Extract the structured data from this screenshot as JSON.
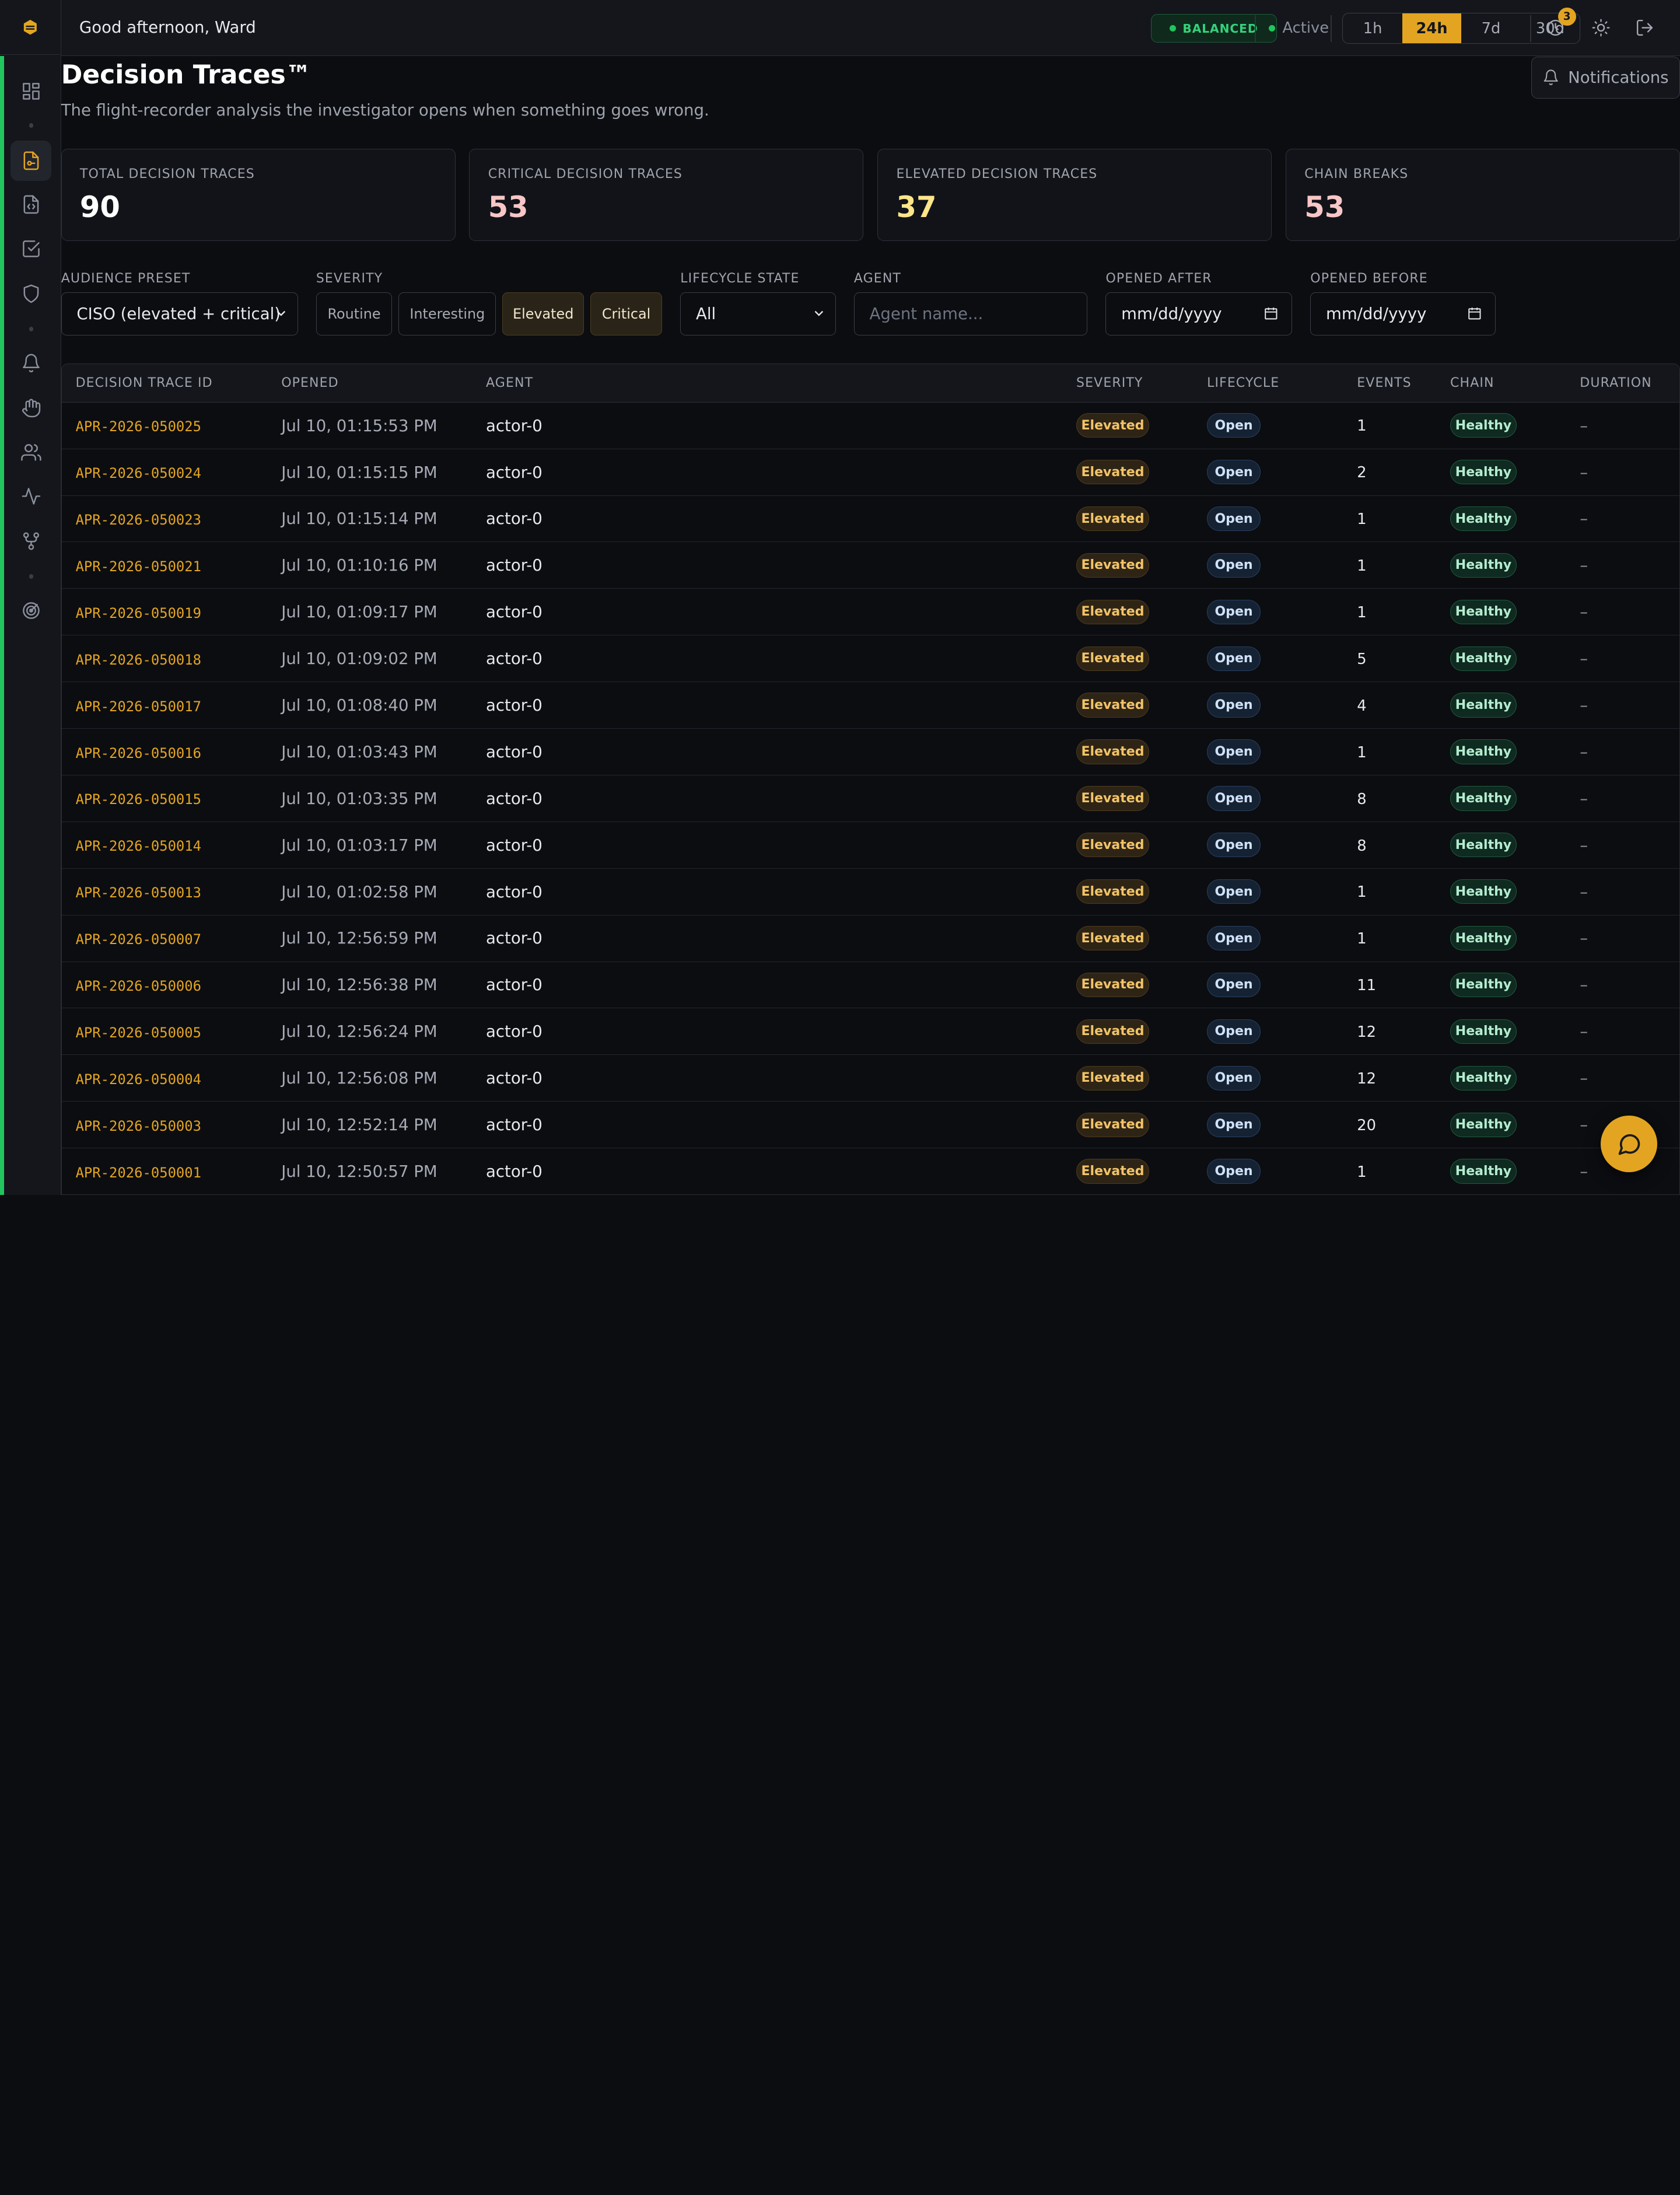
{
  "header": {
    "greeting": "Good afternoon, Ward",
    "mode_badge": "BALANCED",
    "status": "Active",
    "time_ranges": [
      "1h",
      "24h",
      "7d",
      "30d"
    ],
    "selected_range": "24h",
    "notification_count": "3"
  },
  "page": {
    "title": "Decision Traces™",
    "subtitle": "The flight-recorder analysis the investigator opens when something goes wrong.",
    "notifications_button": "Notifications"
  },
  "stats": [
    {
      "label": "TOTAL DECISION TRACES",
      "value": "90",
      "color": "#ffffff"
    },
    {
      "label": "CRITICAL DECISION TRACES",
      "value": "53",
      "color": "#f7c6c6"
    },
    {
      "label": "ELEVATED DECISION TRACES",
      "value": "37",
      "color": "#fde58a"
    },
    {
      "label": "CHAIN BREAKS",
      "value": "53",
      "color": "#f7c6c6"
    }
  ],
  "filters": {
    "audience_label": "AUDIENCE PRESET",
    "audience_value": "CISO (elevated + critical)",
    "severity_label": "SEVERITY",
    "severity_options": [
      "Routine",
      "Interesting",
      "Elevated",
      "Critical"
    ],
    "lifecycle_label": "LIFECYCLE STATE",
    "lifecycle_value": "All",
    "agent_label": "AGENT",
    "agent_placeholder": "Agent name...",
    "after_label": "OPENED AFTER",
    "after_placeholder": "mm/dd/yyyy",
    "before_label": "OPENED BEFORE",
    "before_placeholder": "mm/dd/yyyy"
  },
  "table": {
    "columns": [
      "DECISION TRACE ID",
      "OPENED",
      "AGENT",
      "SEVERITY",
      "LIFECYCLE",
      "EVENTS",
      "CHAIN",
      "DURATION"
    ],
    "rows": [
      [
        "APR-2026-050025",
        "Jul 10, 01:15:53 PM",
        "actor-0",
        "Elevated",
        "Open",
        "1",
        "Healthy",
        "–"
      ],
      [
        "APR-2026-050024",
        "Jul 10, 01:15:15 PM",
        "actor-0",
        "Elevated",
        "Open",
        "2",
        "Healthy",
        "–"
      ],
      [
        "APR-2026-050023",
        "Jul 10, 01:15:14 PM",
        "actor-0",
        "Elevated",
        "Open",
        "1",
        "Healthy",
        "–"
      ],
      [
        "APR-2026-050021",
        "Jul 10, 01:10:16 PM",
        "actor-0",
        "Elevated",
        "Open",
        "1",
        "Healthy",
        "–"
      ],
      [
        "APR-2026-050019",
        "Jul 10, 01:09:17 PM",
        "actor-0",
        "Elevated",
        "Open",
        "1",
        "Healthy",
        "–"
      ],
      [
        "APR-2026-050018",
        "Jul 10, 01:09:02 PM",
        "actor-0",
        "Elevated",
        "Open",
        "5",
        "Healthy",
        "–"
      ],
      [
        "APR-2026-050017",
        "Jul 10, 01:08:40 PM",
        "actor-0",
        "Elevated",
        "Open",
        "4",
        "Healthy",
        "–"
      ],
      [
        "APR-2026-050016",
        "Jul 10, 01:03:43 PM",
        "actor-0",
        "Elevated",
        "Open",
        "1",
        "Healthy",
        "–"
      ],
      [
        "APR-2026-050015",
        "Jul 10, 01:03:35 PM",
        "actor-0",
        "Elevated",
        "Open",
        "8",
        "Healthy",
        "–"
      ],
      [
        "APR-2026-050014",
        "Jul 10, 01:03:17 PM",
        "actor-0",
        "Elevated",
        "Open",
        "8",
        "Healthy",
        "–"
      ],
      [
        "APR-2026-050013",
        "Jul 10, 01:02:58 PM",
        "actor-0",
        "Elevated",
        "Open",
        "1",
        "Healthy",
        "–"
      ],
      [
        "APR-2026-050007",
        "Jul 10, 12:56:59 PM",
        "actor-0",
        "Elevated",
        "Open",
        "1",
        "Healthy",
        "–"
      ],
      [
        "APR-2026-050006",
        "Jul 10, 12:56:38 PM",
        "actor-0",
        "Elevated",
        "Open",
        "11",
        "Healthy",
        "–"
      ],
      [
        "APR-2026-050005",
        "Jul 10, 12:56:24 PM",
        "actor-0",
        "Elevated",
        "Open",
        "12",
        "Healthy",
        "–"
      ],
      [
        "APR-2026-050004",
        "Jul 10, 12:56:08 PM",
        "actor-0",
        "Elevated",
        "Open",
        "12",
        "Healthy",
        "–"
      ],
      [
        "APR-2026-050003",
        "Jul 10, 12:52:14 PM",
        "actor-0",
        "Elevated",
        "Open",
        "20",
        "Healthy",
        "–"
      ],
      [
        "APR-2026-050001",
        "Jul 10, 12:50:57 PM",
        "actor-0",
        "Elevated",
        "Open",
        "1",
        "Healthy",
        "–"
      ]
    ]
  },
  "icons": {
    "sidebar": [
      "dashboard-icon",
      "decision-traces-icon",
      "code-file-icon",
      "checklist-icon",
      "shield-icon",
      "bell-icon",
      "hand-icon",
      "users-icon",
      "activity-icon",
      "workflow-icon",
      "radar-icon"
    ],
    "topbar": [
      "history-icon",
      "sun-icon",
      "logout-icon"
    ],
    "chat": "chat-icon"
  }
}
